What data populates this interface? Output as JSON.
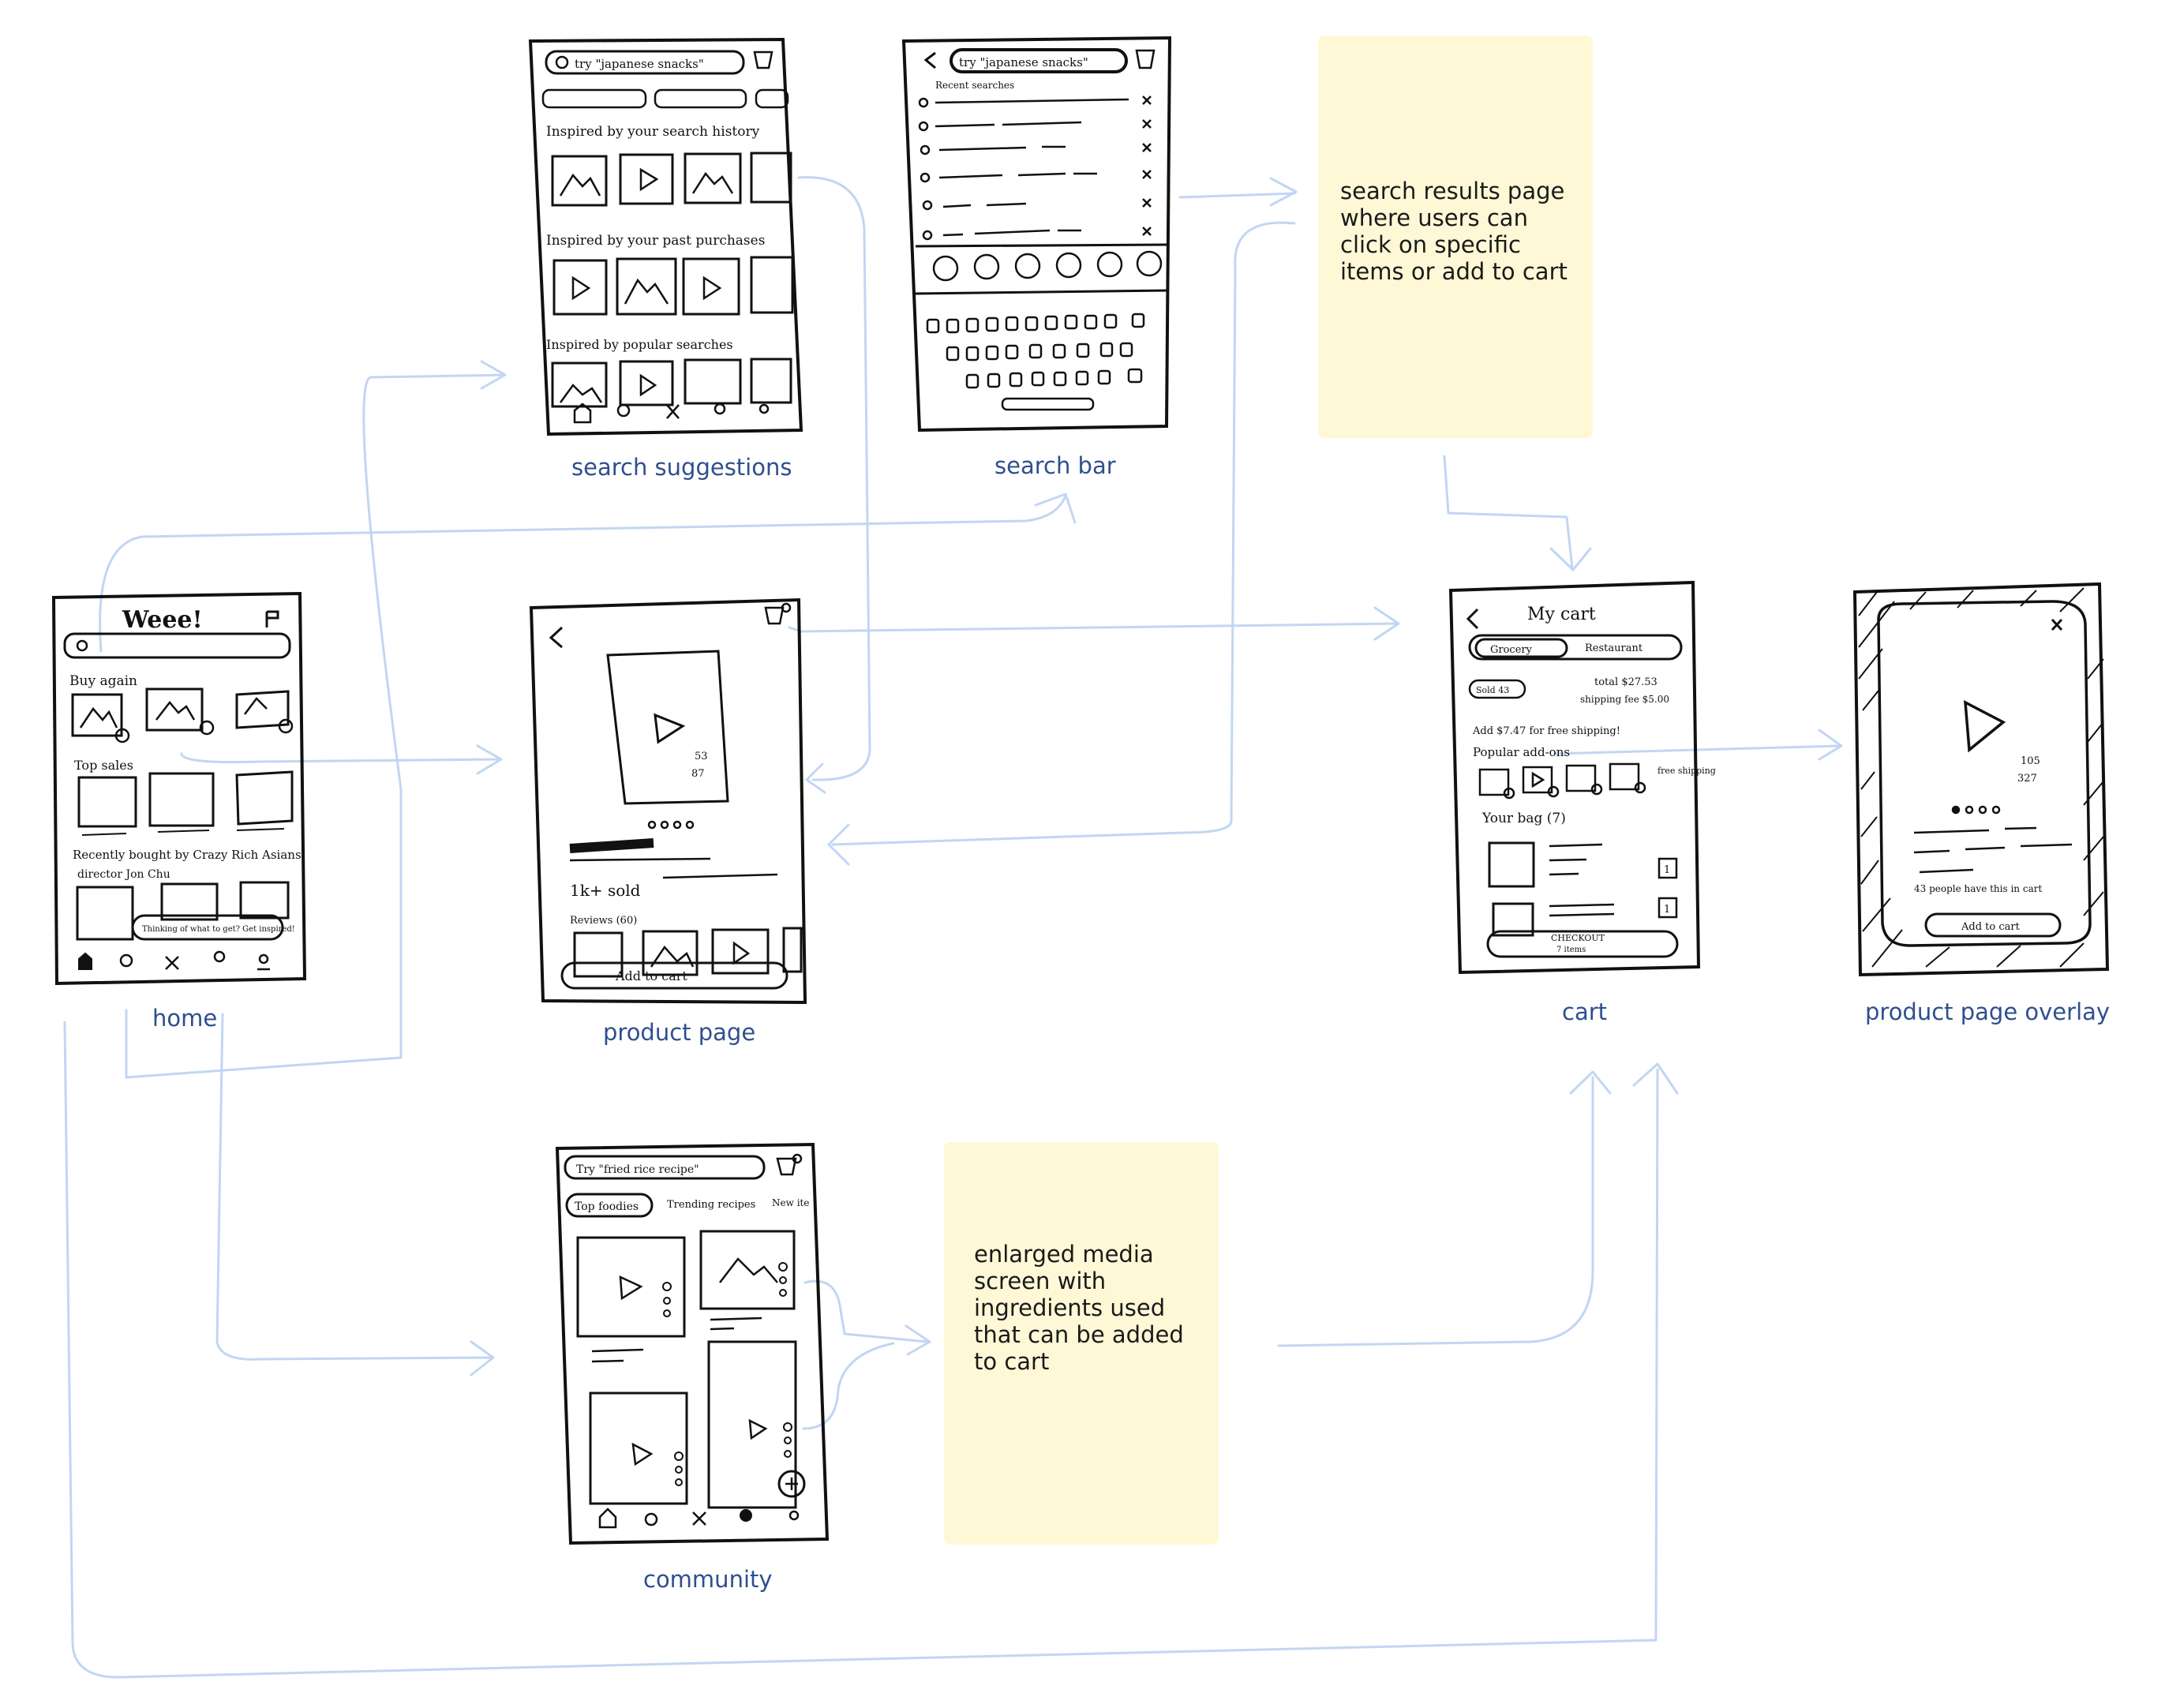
{
  "captions": {
    "search_suggestions": "search suggestions",
    "search_bar": "search bar",
    "home": "home",
    "product_page": "product page",
    "cart": "cart",
    "product_page_overlay": "product page overlay",
    "community": "community"
  },
  "notes": {
    "search_results": "search results page\nwhere users can\nclick on specific\nitems or add to cart",
    "enlarged_media": "enlarged media\nscreen with\ningredients used\nthat can be added\nto cart"
  },
  "home": {
    "logo": "Weee!",
    "buy_again": "Buy again",
    "top_sales": "Top sales",
    "recently_bought": "Recently bought by Crazy Rich Asians",
    "director": "director Jon Chu",
    "bubble": "Thinking of what to get? Get inspired!"
  },
  "search_suggestions": {
    "search_text": "try \"japanese snacks\"",
    "inspired_history": "Inspired by your search history",
    "inspired_purchases": "Inspired by your past purchases",
    "inspired_popular": "Inspired by popular searches"
  },
  "search_bar": {
    "search_text": "try \"japanese snacks\"",
    "recent_searches": "Recent searches"
  },
  "product_page": {
    "likes": "53",
    "comments": "87",
    "sold": "1k+ sold",
    "reviews": "Reviews (60)",
    "add_to_cart": "Add to cart"
  },
  "cart": {
    "title": "My cart",
    "tab_grocery": "Grocery",
    "tab_restaurant": "Restaurant",
    "sold_by": "Sold 43",
    "total": "total $27.53",
    "shipping": "shipping fee $5.00",
    "free_shipping": "Add $7.47 for free shipping!",
    "popular_addons": "Popular add-ons",
    "free_shipping_badge": "free shipping",
    "your_bag": "Your bag (7)",
    "qty": "1",
    "checkout": "CHECKOUT",
    "checkout_items": "7 items"
  },
  "overlay": {
    "likes": "105",
    "comments": "327",
    "people_note": "43 people have this in cart",
    "add_to_cart": "Add to cart"
  },
  "community": {
    "search_text": "Try \"fried rice recipe\"",
    "tab_top_foodies": "Top foodies",
    "tab_trending": "Trending recipes",
    "tab_new": "New ite"
  },
  "colors": {
    "flow_arrow": "#c2d6f3",
    "caption": "#2f4f8f",
    "sticky": "#fff8d6",
    "ink": "#111111"
  }
}
